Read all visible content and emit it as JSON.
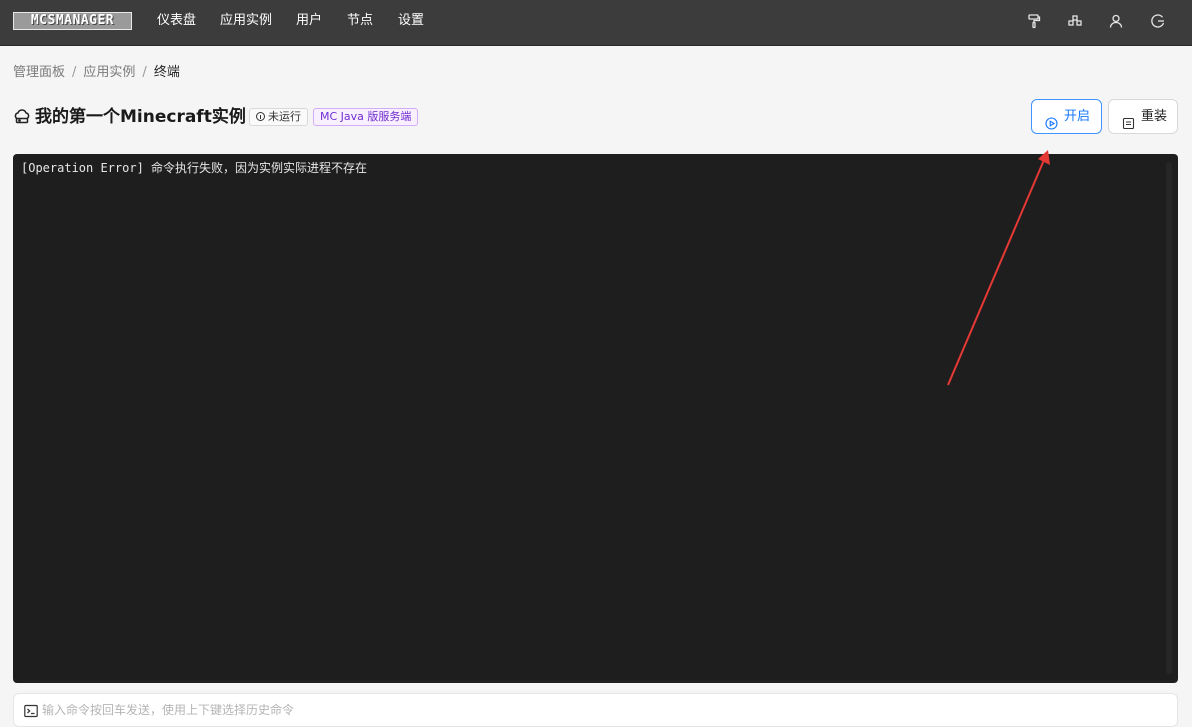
{
  "header": {
    "logo_text": "MCSMANAGER",
    "nav": [
      {
        "label": "仪表盘"
      },
      {
        "label": "应用实例"
      },
      {
        "label": "用户"
      },
      {
        "label": "节点"
      },
      {
        "label": "设置"
      }
    ],
    "icons": [
      "paint-roller-icon",
      "cluster-icon",
      "user-icon",
      "logout-icon"
    ]
  },
  "breadcrumb": {
    "items": [
      "管理面板",
      "应用实例"
    ],
    "current": "终端",
    "separator": "/"
  },
  "instance": {
    "icon": "cloud-server-icon",
    "title": "我的第一个Minecraft实例",
    "status_label": "未运行",
    "type_label": "MC Java 版服务端"
  },
  "actions": {
    "start_label": "开启",
    "reinstall_label": "重装"
  },
  "terminal": {
    "lines": [
      "[Operation Error] 命令执行失败，因为实例实际进程不存在"
    ]
  },
  "command": {
    "placeholder": "输入命令按回车发送，使用上下键选择历史命令",
    "value": ""
  },
  "colors": {
    "topbar": "#3c3c3c",
    "primary": "#1677ff",
    "terminal_bg": "#1e1e1e",
    "tag_purple": "#722ed1",
    "annotation_arrow": "#e53935"
  }
}
